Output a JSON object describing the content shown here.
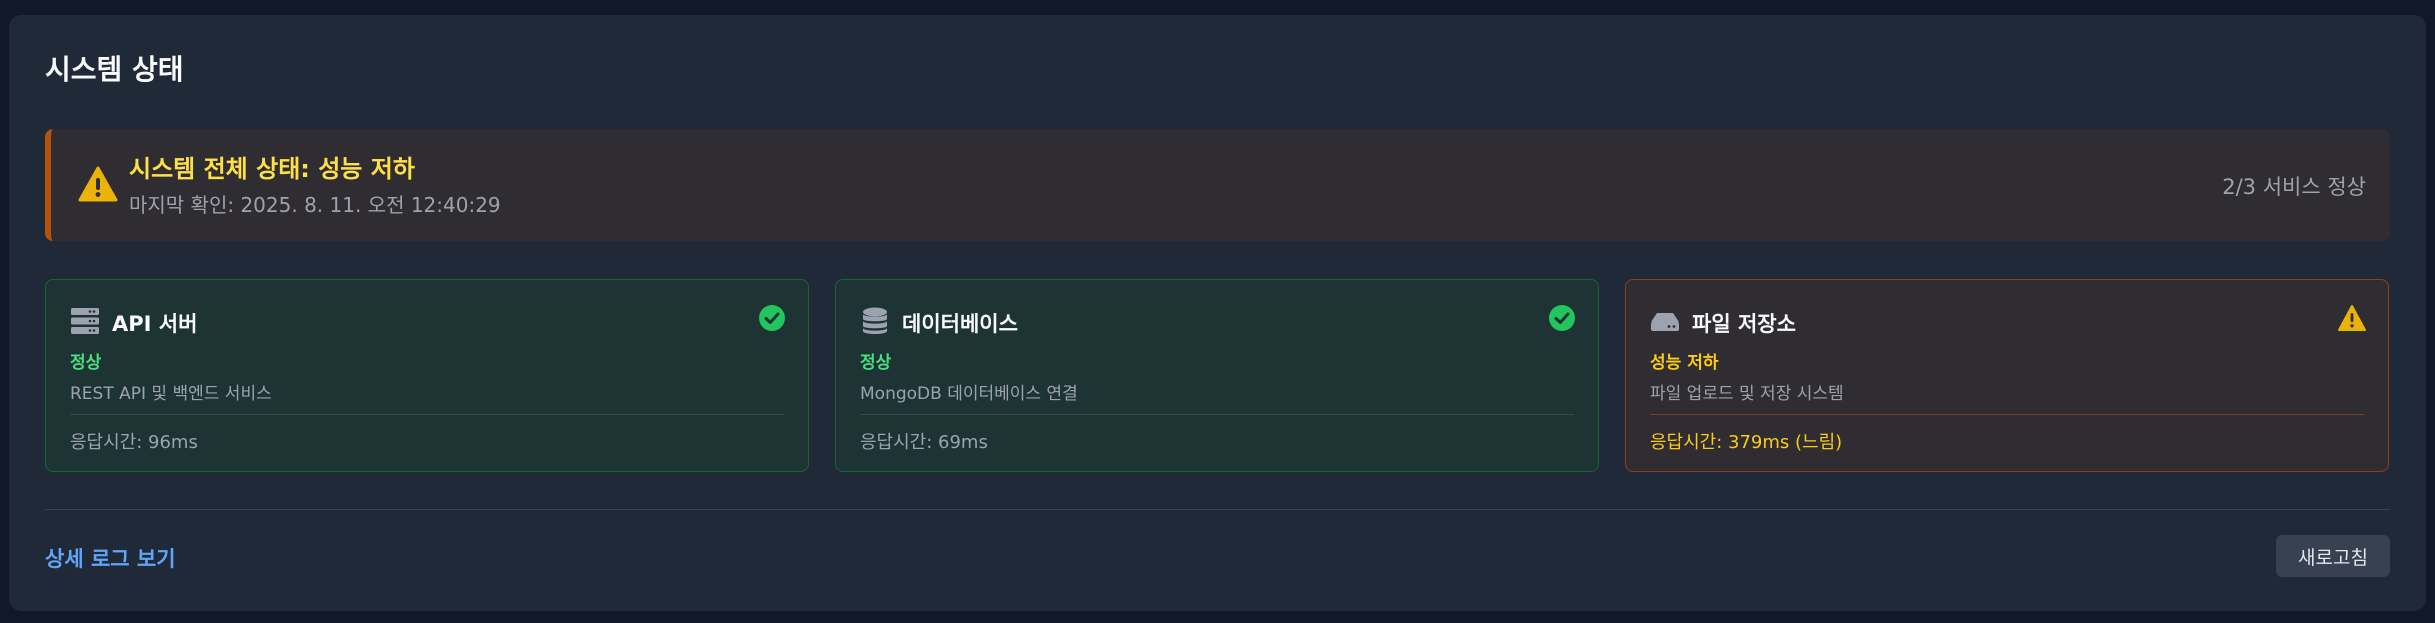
{
  "header": {
    "title": "시스템 상태"
  },
  "overall": {
    "title": "시스템 전체 상태: 성능 저하",
    "last_checked": "마지막 확인: 2025. 8. 11. 오전 12:40:29",
    "summary": "2/3 서비스 정상",
    "icon": "warning-icon",
    "accent_color": "#b45309",
    "title_color": "#fde047"
  },
  "services": [
    {
      "name": "API 서버",
      "icon": "server-icon",
      "status": "정상",
      "status_icon": "check-circle-icon",
      "description": "REST API 및 백엔드 서비스",
      "response": "응답시간: 96ms",
      "color": "#22c55e"
    },
    {
      "name": "데이터베이스",
      "icon": "database-icon",
      "status": "정상",
      "status_icon": "check-circle-icon",
      "description": "MongoDB 데이터베이스 연결",
      "response": "응답시간: 69ms",
      "color": "#22c55e"
    },
    {
      "name": "파일 저장소",
      "icon": "hard-drive-icon",
      "status": "성능 저하",
      "status_icon": "warning-icon",
      "description": "파일 업로드 및 저장 시스템",
      "response": "응답시간: 379ms (느림)",
      "color": "#facc15"
    }
  ],
  "footer": {
    "detail_link": "상세 로그 보기",
    "refresh_label": "새로고침"
  }
}
